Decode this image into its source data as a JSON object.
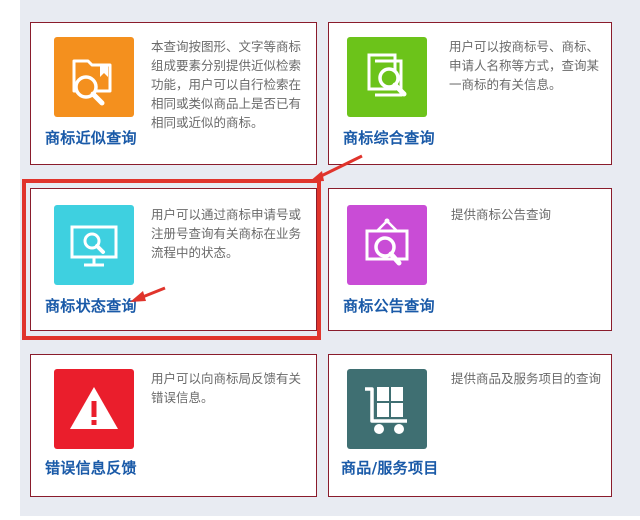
{
  "cards": [
    {
      "title": "商标近似查询",
      "description": "本查询按图形、文字等商标组成要素分别提供近似检索功能，用户可以自行检索在相同或类似商品上是否已有相同或近似的商标。",
      "icon": "folder-search-icon",
      "color": "#f4901e"
    },
    {
      "title": "商标综合查询",
      "description": "用户可以按商标号、商标、申请人名称等方式，查询某一商标的有关信息。",
      "icon": "documents-search-icon",
      "color": "#6cc31a"
    },
    {
      "title": "商标状态查询",
      "description": "用户可以通过商标申请号或注册号查询有关商标在业务流程中的状态。",
      "icon": "monitor-search-icon",
      "color": "#3ed0e0"
    },
    {
      "title": "商标公告查询",
      "description": "提供商标公告查询",
      "icon": "notice-board-search-icon",
      "color": "#c94cd6"
    },
    {
      "title": "错误信息反馈",
      "description": "用户可以向商标局反馈有关错误信息。",
      "icon": "warning-icon",
      "color": "#ea1e2c"
    },
    {
      "title": "商品/服务项目",
      "description": "提供商品及服务项目的查询",
      "icon": "cart-icon",
      "color": "#3f6f72"
    }
  ],
  "accent_color": "#e0342c"
}
